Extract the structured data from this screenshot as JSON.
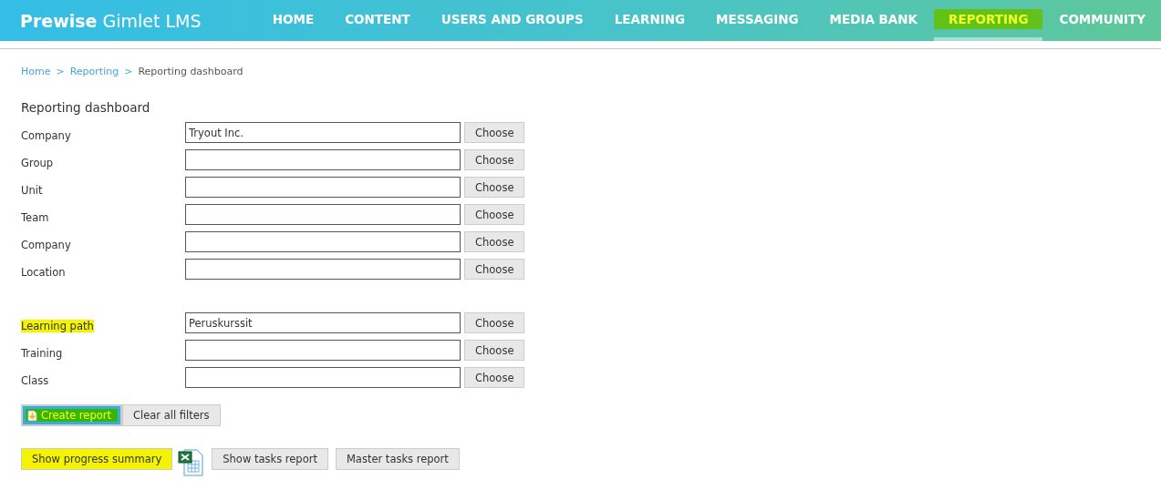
{
  "header": {
    "brand_bold": "Prewise",
    "brand_rest": "Gimlet LMS",
    "nav": [
      {
        "label": "HOME",
        "selected": false,
        "highlighted": false
      },
      {
        "label": "CONTENT",
        "selected": false,
        "highlighted": false
      },
      {
        "label": "USERS AND GROUPS",
        "selected": false,
        "highlighted": false
      },
      {
        "label": "LEARNING",
        "selected": false,
        "highlighted": false
      },
      {
        "label": "MESSAGING",
        "selected": false,
        "highlighted": false
      },
      {
        "label": "MEDIA BANK",
        "selected": false,
        "highlighted": false
      },
      {
        "label": "REPORTING",
        "selected": true,
        "highlighted": true
      },
      {
        "label": "COMMUNITY",
        "selected": false,
        "highlighted": false
      }
    ]
  },
  "breadcrumb": [
    {
      "label": "Home",
      "kind": "link"
    },
    {
      "label": "Reporting",
      "kind": "link"
    },
    {
      "label": "Reporting dashboard",
      "kind": "current"
    }
  ],
  "breadcrumb_separator": ">",
  "title": "Reporting dashboard",
  "filter_groups": [
    [
      {
        "label": "Company",
        "value": "Tryout Inc.",
        "button": "Choose",
        "highlighted": false
      },
      {
        "label": "Group",
        "button": "Choose",
        "highlighted": false
      },
      {
        "label": "Unit",
        "button": "Choose",
        "highlighted": false
      },
      {
        "label": "Team",
        "button": "Choose",
        "highlighted": false
      },
      {
        "label": "Company",
        "button": "Choose",
        "highlighted": false
      },
      {
        "label": "Location",
        "button": "Choose",
        "highlighted": false
      }
    ],
    [
      {
        "label": "Learning path",
        "value": "Peruskurssit",
        "button": "Choose",
        "highlighted": true
      },
      {
        "label": "Training",
        "button": "Choose",
        "highlighted": false
      },
      {
        "label": "Class",
        "button": "Choose",
        "highlighted": false
      }
    ]
  ],
  "actions": [
    {
      "label": "Create report",
      "kind": "primary",
      "highlighted": true
    },
    {
      "label": "Clear all filters",
      "kind": "plain",
      "highlighted": false
    }
  ],
  "reports": [
    {
      "label": "Show progress summary",
      "kind": "button",
      "highlighted": true
    },
    {
      "kind": "excel"
    },
    {
      "label": "Show tasks report",
      "kind": "button",
      "highlighted": false
    },
    {
      "label": "Master tasks report",
      "kind": "button",
      "highlighted": false
    }
  ]
}
